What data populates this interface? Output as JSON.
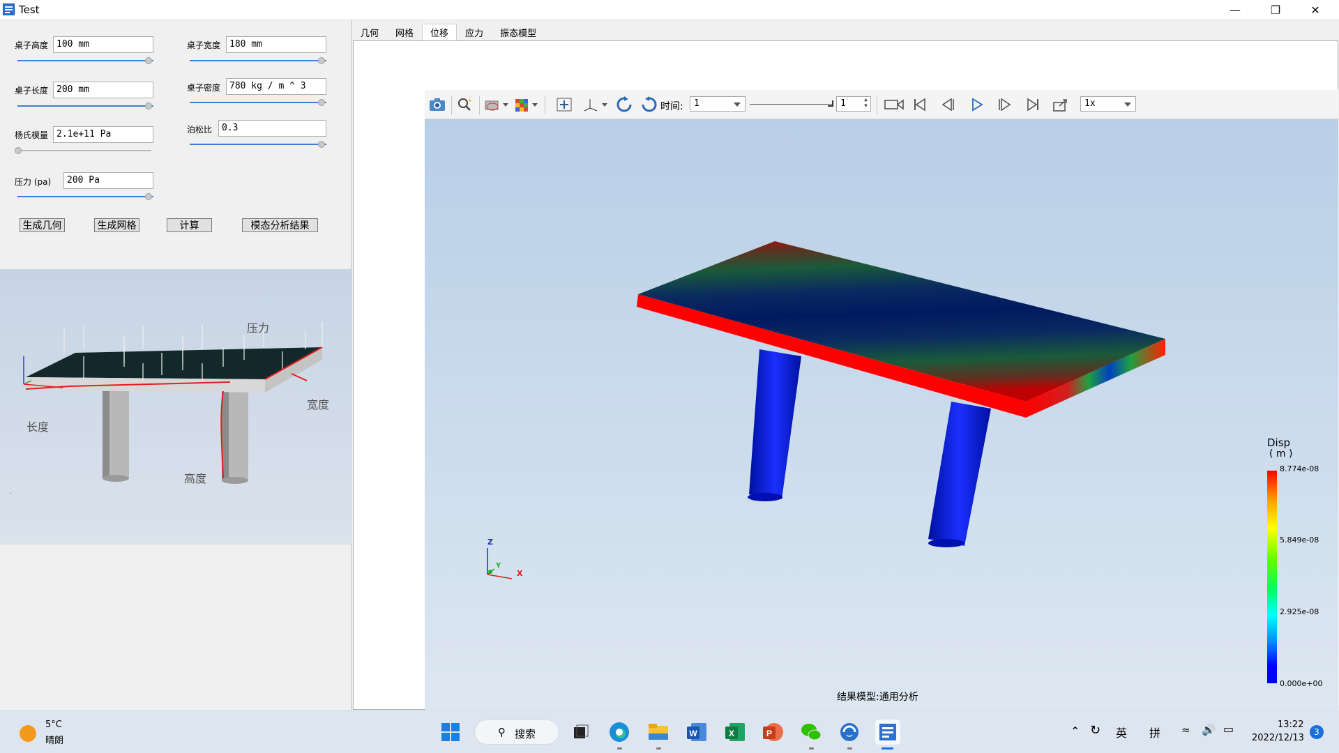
{
  "window": {
    "title": "Test"
  },
  "params": {
    "table_height_label": "桌子高度",
    "table_height_value": "100 mm",
    "table_width_label": "桌子宽度",
    "table_width_value": "180 mm",
    "table_length_label": "桌子长度",
    "table_length_value": "200 mm",
    "table_density_label": "桌子密度",
    "table_density_value": "780 kg / m ^ 3",
    "youngs_label": "杨氏模量",
    "youngs_value": "2.1e+11 Pa",
    "poisson_label": "泊松比",
    "poisson_value": "0.3",
    "pressure_label": "压力 (pa)",
    "pressure_value": "200 Pa"
  },
  "buttons": {
    "gen_geometry": "生成几何",
    "gen_mesh": "生成网格",
    "compute": "计算",
    "modal_results": "模态分析结果"
  },
  "preview": {
    "pressure_label": "压力",
    "width_label": "宽度",
    "length_label": "长度",
    "height_label": "高度"
  },
  "tabs": [
    {
      "label": "几何"
    },
    {
      "label": "网格"
    },
    {
      "label": "位移"
    },
    {
      "label": "应力"
    },
    {
      "label": "振态模型"
    }
  ],
  "toolbar": {
    "time_label": "时间:",
    "time_value": "1",
    "frame_value": "1",
    "speed_value": "1x"
  },
  "legend": {
    "title": "Disp",
    "unit": "( m )",
    "ticks": [
      "8.774e-08",
      "5.849e-08",
      "2.925e-08",
      "0.000e+00"
    ]
  },
  "triad": {
    "x": "X",
    "y": "Y",
    "z": "Z"
  },
  "status_text": "结果模型:通用分析",
  "taskbar": {
    "weather_temp": "5°C",
    "weather_desc": "晴朗",
    "search_label": "搜索",
    "ime_lang": "英",
    "ime_mode": "拼",
    "time": "13:22",
    "date": "2022/12/13",
    "notification_count": "3"
  },
  "colors": {
    "accent": "#3f7ed5",
    "high": "#ff0000",
    "low": "#0000ff"
  }
}
